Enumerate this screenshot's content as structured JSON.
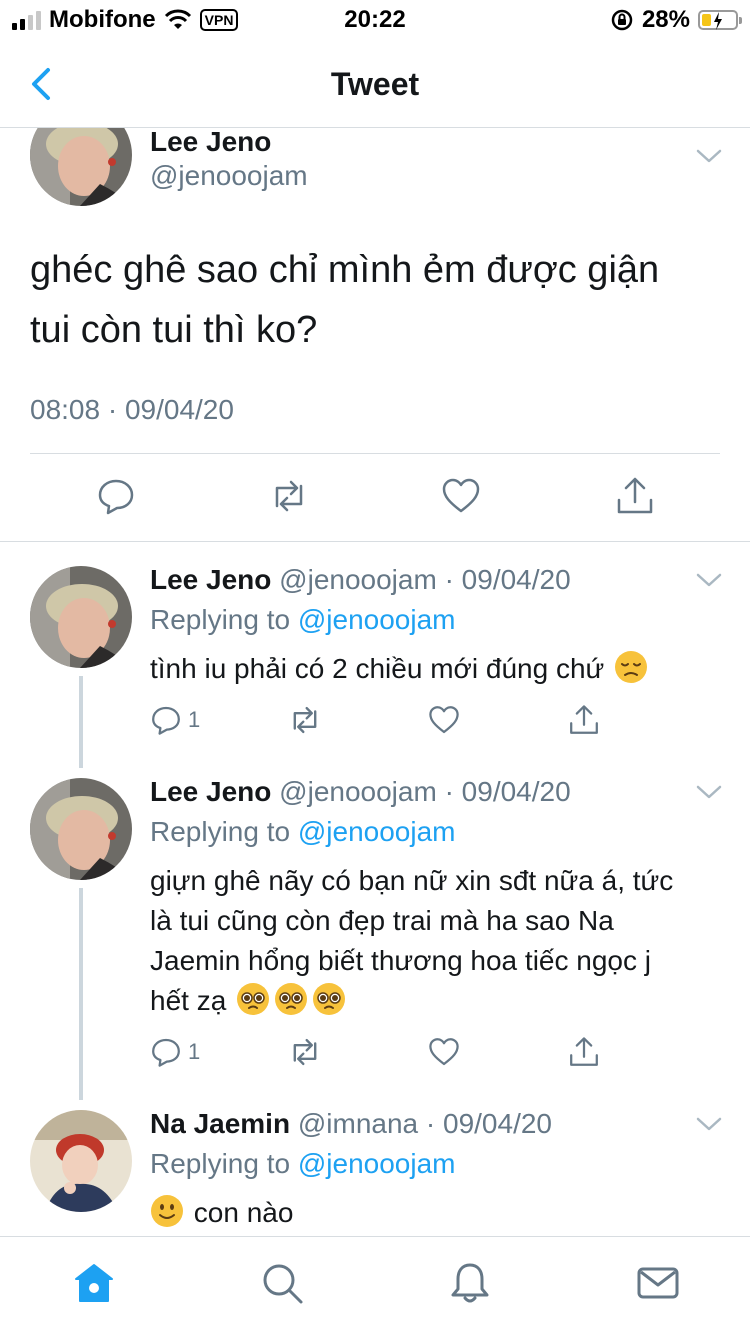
{
  "status_bar": {
    "carrier": "Mobifone",
    "vpn": "VPN",
    "time": "20:22",
    "battery": "28%",
    "battery_level": 0.28
  },
  "nav": {
    "title": "Tweet",
    "back_icon": "chevron-left-icon"
  },
  "main_tweet": {
    "name": "Lee Jeno",
    "handle": "@jenooojam",
    "text_line1": "ghéc ghê sao chỉ mình ẻm được giận",
    "text_line2": "tui còn tui thì ko?",
    "timestamp": "08:08 · 09/04/20"
  },
  "replies": [
    {
      "name": "Lee Jeno",
      "meta": "@jenooojam · 09/04/20",
      "replying_prefix": "Replying to ",
      "replying_handle": "@jenooojam",
      "text": "tình iu phải có 2 chiều mới đúng chứ",
      "reply_count": "1"
    },
    {
      "name": "Lee Jeno",
      "meta": "@jenooojam · 09/04/20",
      "replying_prefix": "Replying to ",
      "replying_handle": "@jenooojam",
      "text_line1": "giựn ghê nãy có bạn nữ xin sđt nữa á, tức",
      "text_line2": "là tui cũng còn đẹp trai mà ha sao Na",
      "text_line3": "Jaemin hổng biết thương hoa tiếc ngọc j",
      "text_line4": "hết zạ",
      "reply_count": "1"
    },
    {
      "name": "Na Jaemin",
      "meta": "@imnana · 09/04/20",
      "replying_prefix": "Replying to ",
      "replying_handle": "@jenooojam",
      "text": "con nào"
    }
  ],
  "tabbar": [
    "home-icon",
    "search-icon",
    "notifications-icon",
    "messages-icon"
  ],
  "colors": {
    "accent": "#1da1f2",
    "secondary_text": "#657786",
    "divider": "#d8dde1"
  }
}
